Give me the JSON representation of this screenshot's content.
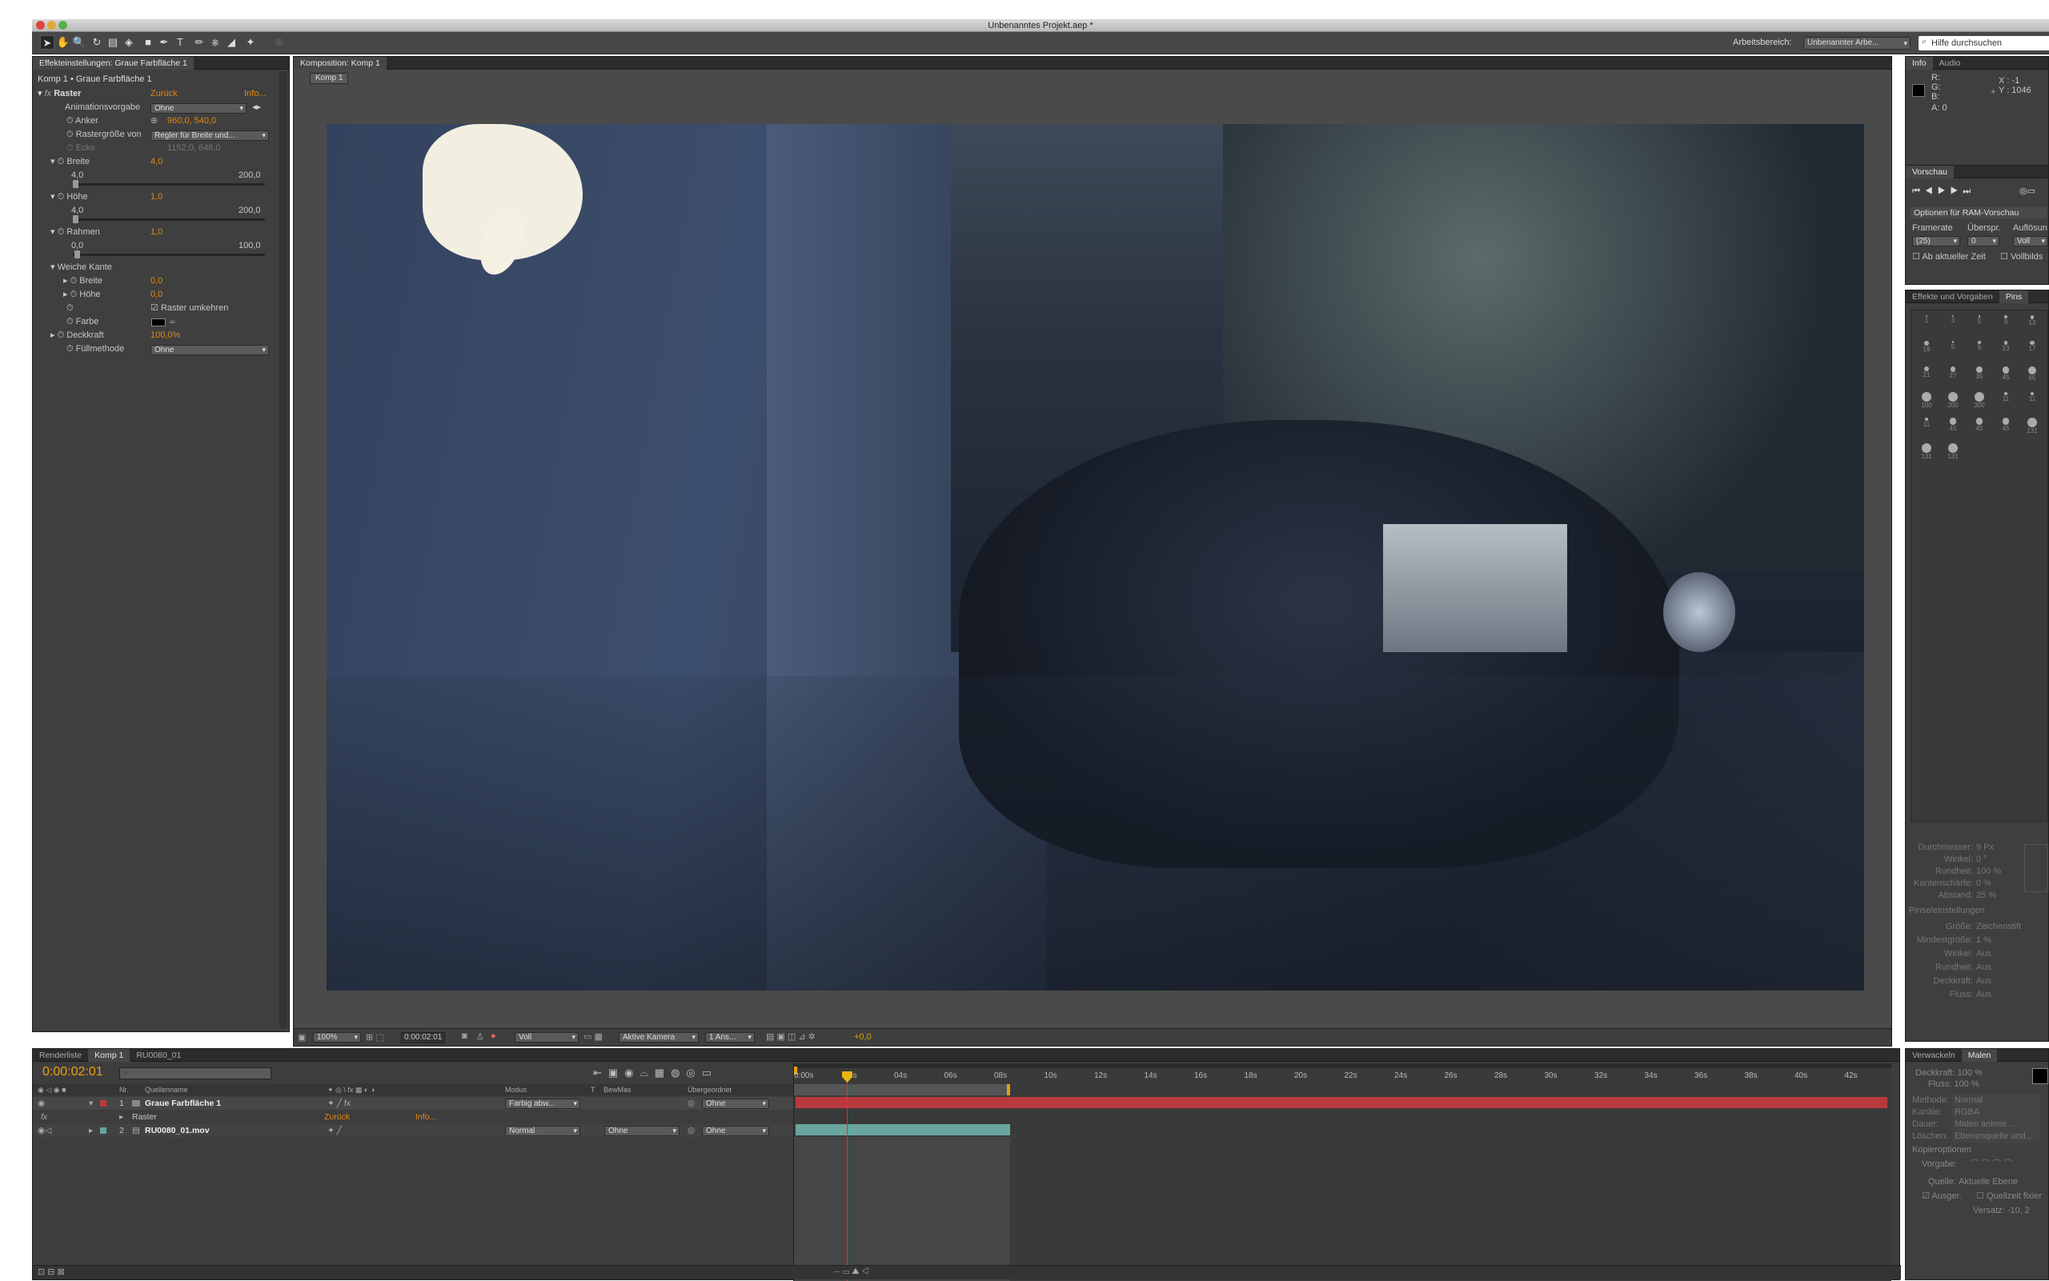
{
  "window": {
    "title": "Unbenanntes Projekt.aep *"
  },
  "toolbar": {
    "workspace_label": "Arbeitsbereich:",
    "workspace_value": "Unbenannter Arbe...",
    "search_placeholder": "Hilfe durchsuchen"
  },
  "effects_panel": {
    "tab": "Effekteinstellungen: Graue Farbfläche 1",
    "breadcrumb": "Komp 1 • Graue Farbfläche 1",
    "effect_name": "Raster",
    "reset": "Zurück",
    "info": "Info...",
    "rows": {
      "animationsvorgabe": {
        "label": "Animationsvorgabe",
        "value": "Ohne"
      },
      "anker": {
        "label": "Anker",
        "value": "960,0, 540,0"
      },
      "rastergroesse": {
        "label": "Rastergröße von",
        "value": "Regler für Breite und..."
      },
      "ecke": {
        "label": "Ecke",
        "value": "1152,0, 648,0"
      },
      "breite": {
        "label": "Breite",
        "value": "4,0",
        "min": "4,0",
        "max": "200,0"
      },
      "hoehe": {
        "label": "Höhe",
        "value": "1,0",
        "min": "4,0",
        "max": "200,0"
      },
      "rahmen": {
        "label": "Rahmen",
        "value": "1,0",
        "min": "0,0",
        "max": "100,0"
      },
      "weiche_kante": {
        "label": "Weiche Kante"
      },
      "wk_breite": {
        "label": "Breite",
        "value": "0,0"
      },
      "wk_hoehe": {
        "label": "Höhe",
        "value": "0,0"
      },
      "raster_umkehren": {
        "label": "Raster umkehren",
        "checked": true
      },
      "farbe": {
        "label": "Farbe"
      },
      "deckkraft": {
        "label": "Deckkraft",
        "value": "100,0%"
      },
      "fuellmethode": {
        "label": "Füllmethode",
        "value": "Ohne"
      }
    }
  },
  "comp_panel": {
    "tab": "Komposition: Komp 1",
    "subtab": "Komp 1",
    "zoom": "100%",
    "timecode": "0:00:02:01",
    "resolution": "Voll",
    "camera": "Aktive Kamera",
    "views": "1 Ans...",
    "exposure": "+0,0"
  },
  "info_panel": {
    "tabs": [
      "Info",
      "Audio"
    ],
    "r": "R:",
    "g": "G:",
    "b": "B:",
    "a": "A: 0",
    "x": "X : -1",
    "y": "Y : 1046"
  },
  "preview_panel": {
    "tab": "Vorschau",
    "ram_options": "Optionen für RAM-Vorschau",
    "framerate_label": "Framerate",
    "skip_label": "Überspr.",
    "res_label": "Auflösun",
    "framerate_value": "(25)",
    "skip_value": "0",
    "res_value": "Voll",
    "from_current": "Ab aktueller Zeit",
    "fullscreen": "Vollbilds"
  },
  "brushes_panel": {
    "tabs": [
      "Effekte und Vorgaben",
      "Pins"
    ],
    "sizes": [
      "1",
      "3",
      "5",
      "9",
      "13",
      "19",
      "5",
      "9",
      "13",
      "17",
      "21",
      "27",
      "35",
      "45",
      "65",
      "100",
      "200",
      "300",
      "11",
      "11",
      "11",
      "45",
      "45",
      "45",
      "131",
      "131",
      "131"
    ],
    "settings": [
      {
        "label": "Durchmesser:",
        "value": "9 Px"
      },
      {
        "label": "Winkel:",
        "value": "0 °"
      },
      {
        "label": "Rundheit:",
        "value": "100 %"
      },
      {
        "label": "Kantenschärfe:",
        "value": "0 %"
      },
      {
        "label": "Abstand:",
        "value": "25 %"
      }
    ],
    "section": "Pinseleinstellungen",
    "settings2": [
      {
        "label": "Größe:",
        "value": "Zeichenstift"
      },
      {
        "label": "Mindestgröße:",
        "value": "1 %"
      },
      {
        "label": "Winkel:",
        "value": "Aus"
      },
      {
        "label": "Rundheit:",
        "value": "Aus"
      },
      {
        "label": "Deckkraft:",
        "value": "Aus"
      },
      {
        "label": "Fluss:",
        "value": "Aus"
      }
    ]
  },
  "paint_panel": {
    "tabs": [
      "Verwackeln",
      "Malen"
    ],
    "opacity": "Deckkraft: 100 %",
    "flow": "Fluss: 100 %",
    "rows": [
      {
        "label": "Methode:",
        "value": "Normal"
      },
      {
        "label": "Kanäle:",
        "value": "RGBA"
      },
      {
        "label": "Dauer:",
        "value": "Malen animie..."
      },
      {
        "label": "Löschen:",
        "value": "Ebenenquelle und..."
      }
    ],
    "copy_options": "Kopieroptionen",
    "preset_label": "Vorgabe:",
    "source_label": "Quelle:",
    "source_value": "Aktuelle Ebene",
    "aligned": "Ausger.",
    "lock_source": "Quellzeit fixier",
    "offset": "Versatz: -10, 2"
  },
  "timeline": {
    "tabs": [
      "Renderliste",
      "Komp 1",
      "RU0080_01"
    ],
    "timecode": "0:00:02:01",
    "columns": {
      "nr": "Nr.",
      "source": "Quellenname",
      "mode": "Modus",
      "t": "T",
      "trkmat": "BewMas",
      "parent": "Übergeordnet"
    },
    "ruler": [
      "0:00s",
      "02s",
      "04s",
      "06s",
      "08s",
      "10s",
      "12s",
      "14s",
      "16s",
      "18s",
      "20s",
      "22s",
      "24s",
      "26s",
      "28s",
      "30s",
      "32s",
      "34s",
      "36s",
      "38s",
      "40s",
      "42s"
    ],
    "layers": [
      {
        "nr": "1",
        "name": "Graue Farbfläche 1",
        "mode": "Farbig abw...",
        "parent": "Ohne",
        "color": "#c0383a"
      },
      {
        "nr": "2",
        "name": "RU0080_01.mov",
        "mode": "Normal",
        "trkmat": "Ohne",
        "parent": "Ohne",
        "color": "#5fa8a0"
      }
    ],
    "effect_row": {
      "name": "Raster",
      "reset": "Zurück",
      "info": "Info..."
    }
  }
}
